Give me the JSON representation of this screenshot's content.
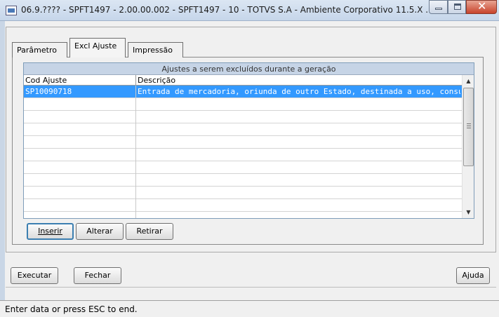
{
  "window": {
    "title": "06.9.???? - SPFT1497 - 2.00.00.002 - SPFT1497 - 10 - TOTVS S.A - Ambiente Corporativo 11.5.X ..."
  },
  "tabs": [
    {
      "label": "Parâmetro",
      "active": false
    },
    {
      "label": "Excl Ajuste",
      "active": true
    },
    {
      "label": "Impressão",
      "active": false
    }
  ],
  "grid": {
    "title": "Ajustes a serem excluídos durante a geração",
    "columns": [
      "Cod Ajuste",
      "Descrição"
    ],
    "rows": [
      {
        "code": "SP10090718",
        "description": "Entrada de mercadoria, oriunda de outro Estado, destinada a uso, consu",
        "selected": true
      },
      {
        "code": "",
        "description": ""
      },
      {
        "code": "",
        "description": ""
      },
      {
        "code": "",
        "description": ""
      },
      {
        "code": "",
        "description": ""
      },
      {
        "code": "",
        "description": ""
      },
      {
        "code": "",
        "description": ""
      },
      {
        "code": "",
        "description": ""
      },
      {
        "code": "",
        "description": ""
      },
      {
        "code": "",
        "description": ""
      }
    ]
  },
  "grid_buttons": {
    "insert": "Inserir",
    "edit": "Alterar",
    "remove": "Retirar"
  },
  "footer_buttons": {
    "execute": "Executar",
    "close": "Fechar",
    "help": "Ajuda"
  },
  "status": {
    "text": "Enter data or press ESC to end."
  },
  "colors": {
    "selection": "#3399ff",
    "grid_title_bg": "#c6d4e6"
  }
}
